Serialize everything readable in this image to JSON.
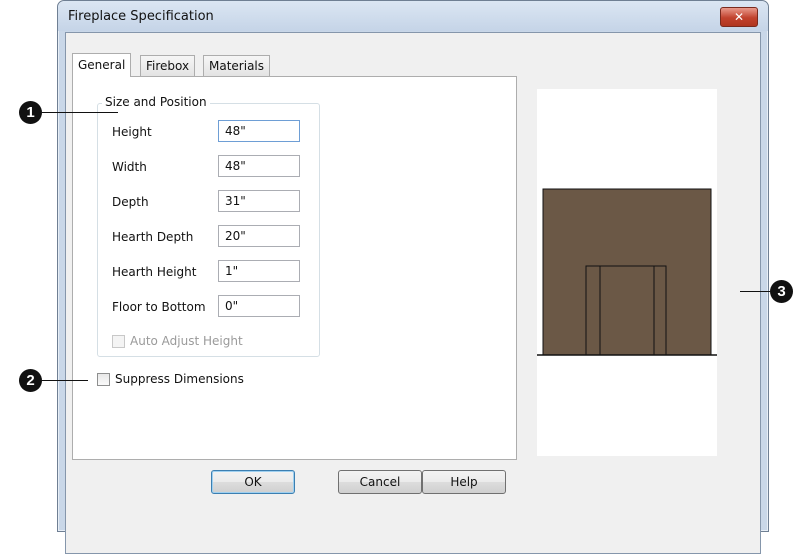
{
  "window": {
    "title": "Fireplace Specification",
    "close_glyph": "✕",
    "close_icon": "close-icon"
  },
  "tabs": [
    {
      "label": "General",
      "active": true
    },
    {
      "label": "Firebox",
      "active": false
    },
    {
      "label": "Materials",
      "active": false
    }
  ],
  "size_position": {
    "legend": "Size and Position",
    "fields": [
      {
        "label": "Height",
        "value": "48\"",
        "focused": true
      },
      {
        "label": "Width",
        "value": "48\""
      },
      {
        "label": "Depth",
        "value": "31\""
      },
      {
        "label": "Hearth Depth",
        "value": "20\""
      },
      {
        "label": "Hearth Height",
        "value": "1\""
      },
      {
        "label": "Floor to Bottom",
        "value": "0\""
      }
    ],
    "auto_adjust": {
      "label": "Auto Adjust Height",
      "checked": false,
      "disabled": true
    }
  },
  "suppress_dimensions": {
    "label": "Suppress Dimensions",
    "checked": false
  },
  "buttons": {
    "ok": "OK",
    "cancel": "Cancel",
    "help": "Help"
  },
  "callouts": [
    "1",
    "2",
    "3"
  ],
  "colors": {
    "fireplace_fill": "#6b5846",
    "fireplace_stroke": "#111111",
    "close_button": "#c1422d",
    "callout": "#111111"
  }
}
